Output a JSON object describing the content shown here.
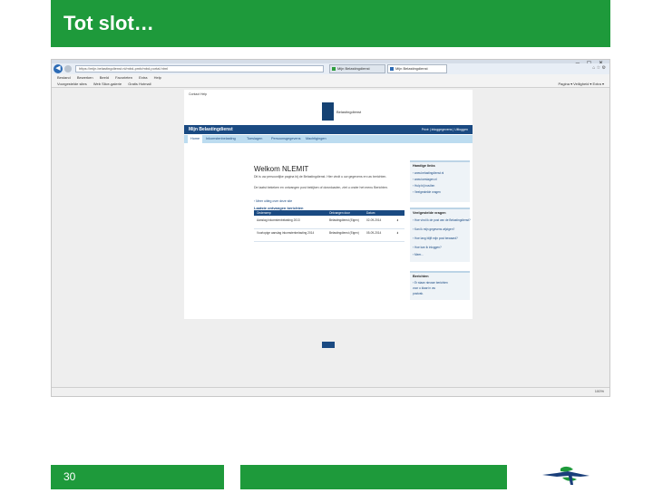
{
  "slide": {
    "title": "Tot slot…",
    "page_number": "30"
  },
  "browser": {
    "address": "https://mijn.belastingdienst.nl/mbd-pmb/mbd.portal.html",
    "tabs": [
      {
        "label": "Mijn Belastingdienst",
        "active": false
      },
      {
        "label": "Mijn Belastingdienst",
        "active": true
      }
    ],
    "menu": [
      "Bestand",
      "Bewerken",
      "Beeld",
      "Favorieten",
      "Extra",
      "Help"
    ],
    "favorites": [
      "Voorgestelde sites",
      "Web Slice-galerie",
      "Gratis Hotmail"
    ],
    "command_right": "Pagina ▾   Veiligheid ▾   Extra ▾",
    "zoom": "100%",
    "page": {
      "breadcrumbs": "Contact   Help",
      "gov_text": "Belastingdienst",
      "header_title": "Mijn Belastingdienst",
      "login_info": "Privé | Inloggegevens | Uitloggen",
      "nav": [
        {
          "label": "Home"
        },
        {
          "label": "Inkomstenbelasting"
        },
        {
          "label": "Toeslagen"
        },
        {
          "label": "Persoonsgegevens"
        },
        {
          "label": "Machtigingen"
        }
      ],
      "welcome": "Welkom NLEMIT",
      "intro1": "Dit is uw persoonlijke pagina bij de Belastingdienst. Hier vindt u uw gegevens en uw berichten.",
      "intro2": "De laatst bekeken en ontvangen post bekijken of downloaden, ziet u onder het menu Berichten.",
      "more_link": "› Meer uitleg over deze site",
      "table_heading": "Laatste ontvangen berichten",
      "table_headers": [
        "Onderwerp",
        "Ontvangen door",
        "Datum"
      ],
      "table_rows": [
        [
          "Aanslag inkomstenbelasting 2013",
          "Belastingdienst (Eigen)",
          "02-09-2014"
        ],
        [
          "Voorlopige aanslag inkomstenbelasting 2014",
          "Belastingdienst (Eigen)",
          "05-09-2014"
        ]
      ],
      "box1": {
        "title": "Handige links",
        "items": [
          "› www.belastingdienst.nl",
          "› www.toeslagen.nl",
          "› Hulp bij invullen",
          "› Veelgestelde vragen"
        ]
      },
      "box2": {
        "title": "Veelgestelde vragen",
        "items": [
          "› Hoe vind ik de post van de Belastingdienst?",
          "› Kan ik mijn gegevens wijzigen?",
          "› Hoe lang blijft mijn post bewaard?",
          "› Hoe kan ik inloggen?",
          "› Meer..."
        ]
      },
      "box3": {
        "title": "Berichten",
        "items": [
          "› Er staan nieuwe berichten",
          "  voor u klaar in uw",
          "  postvak."
        ]
      }
    }
  }
}
